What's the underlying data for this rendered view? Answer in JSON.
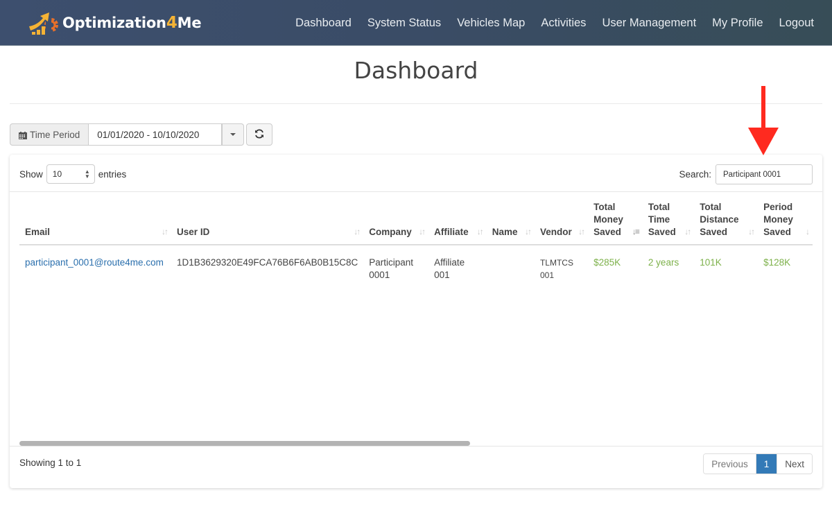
{
  "navbar": {
    "brand_main": "Optimization",
    "brand_four": "4",
    "brand_tail": "Me",
    "logo_icon": "rising-arrow-gear-logo",
    "links": [
      "Dashboard",
      "System Status",
      "Vehicles Map",
      "Activities",
      "User Management",
      "My Profile",
      "Logout"
    ]
  },
  "page": {
    "title": "Dashboard"
  },
  "filters": {
    "time_period_label": "Time Period",
    "time_period_icon": "calendar-icon",
    "date_range": "01/01/2020 - 10/10/2020",
    "refresh_icon": "refresh-icon"
  },
  "table_controls": {
    "show_label": "Show",
    "entries_per_page": "10",
    "entries_label": "entries",
    "search_label": "Search:",
    "search_value": "Participant 0001"
  },
  "table": {
    "columns": [
      {
        "label": "Email",
        "sort": "both"
      },
      {
        "label": "User ID",
        "sort": "both"
      },
      {
        "label": "Company",
        "sort": "both"
      },
      {
        "label": "Affiliate",
        "sort": "both"
      },
      {
        "label": "Name",
        "sort": "both"
      },
      {
        "label": "Vendor",
        "sort": "both"
      },
      {
        "label": "Total Money Saved",
        "sort": "desc-active"
      },
      {
        "label": "Total Time Saved",
        "sort": "both"
      },
      {
        "label": "Total Distance Saved",
        "sort": "both"
      },
      {
        "label": "Period Money Saved",
        "sort": "desc"
      }
    ],
    "rows": [
      {
        "email": "participant_0001@route4me.com",
        "user_id": "1D1B3629320E49FCA76B6F6AB0B15C8C",
        "company": "Participant 0001",
        "affiliate": "Affiliate 001",
        "name": "",
        "vendor": "TLMTCS 001",
        "total_money_saved": "$285K",
        "total_time_saved": "2 years",
        "total_distance_saved": "101K",
        "period_money_saved": "$128K"
      }
    ]
  },
  "footer": {
    "info": "Showing 1 to 1",
    "pagination": {
      "previous": "Previous",
      "current": "1",
      "next": "Next"
    }
  },
  "annotation": {
    "arrow_color": "#ff2a1f",
    "points_to": "search-input"
  },
  "colors": {
    "link": "#2a6fad",
    "positive": "#7db14a",
    "primary": "#337ab7",
    "brand_accent": "#f5b335"
  }
}
